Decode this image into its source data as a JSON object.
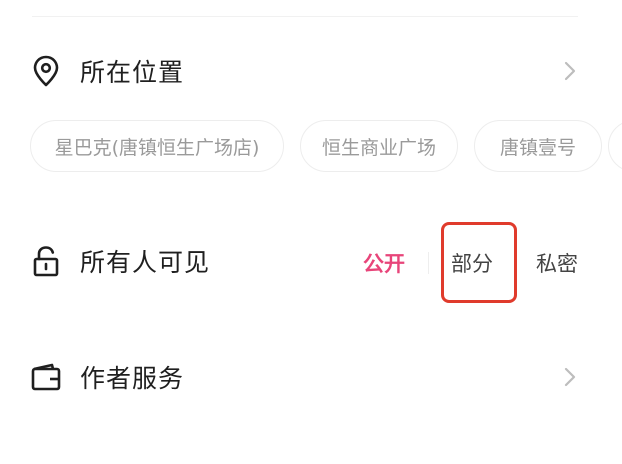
{
  "location": {
    "label": "所在位置",
    "icon": "map-pin-icon",
    "suggestions": [
      "星巴克(唐镇恒生广场店)",
      "恒生商业广场",
      "唐镇壹号"
    ]
  },
  "visibility": {
    "label": "所有人可见",
    "icon": "unlock-icon",
    "options": {
      "public": "公开",
      "partial": "部分",
      "private": "私密"
    },
    "selected": "公开",
    "active_color": "#e8457a"
  },
  "author_services": {
    "label": "作者服务",
    "icon": "wallet-icon"
  },
  "colors": {
    "highlight": "#e03b2c"
  }
}
